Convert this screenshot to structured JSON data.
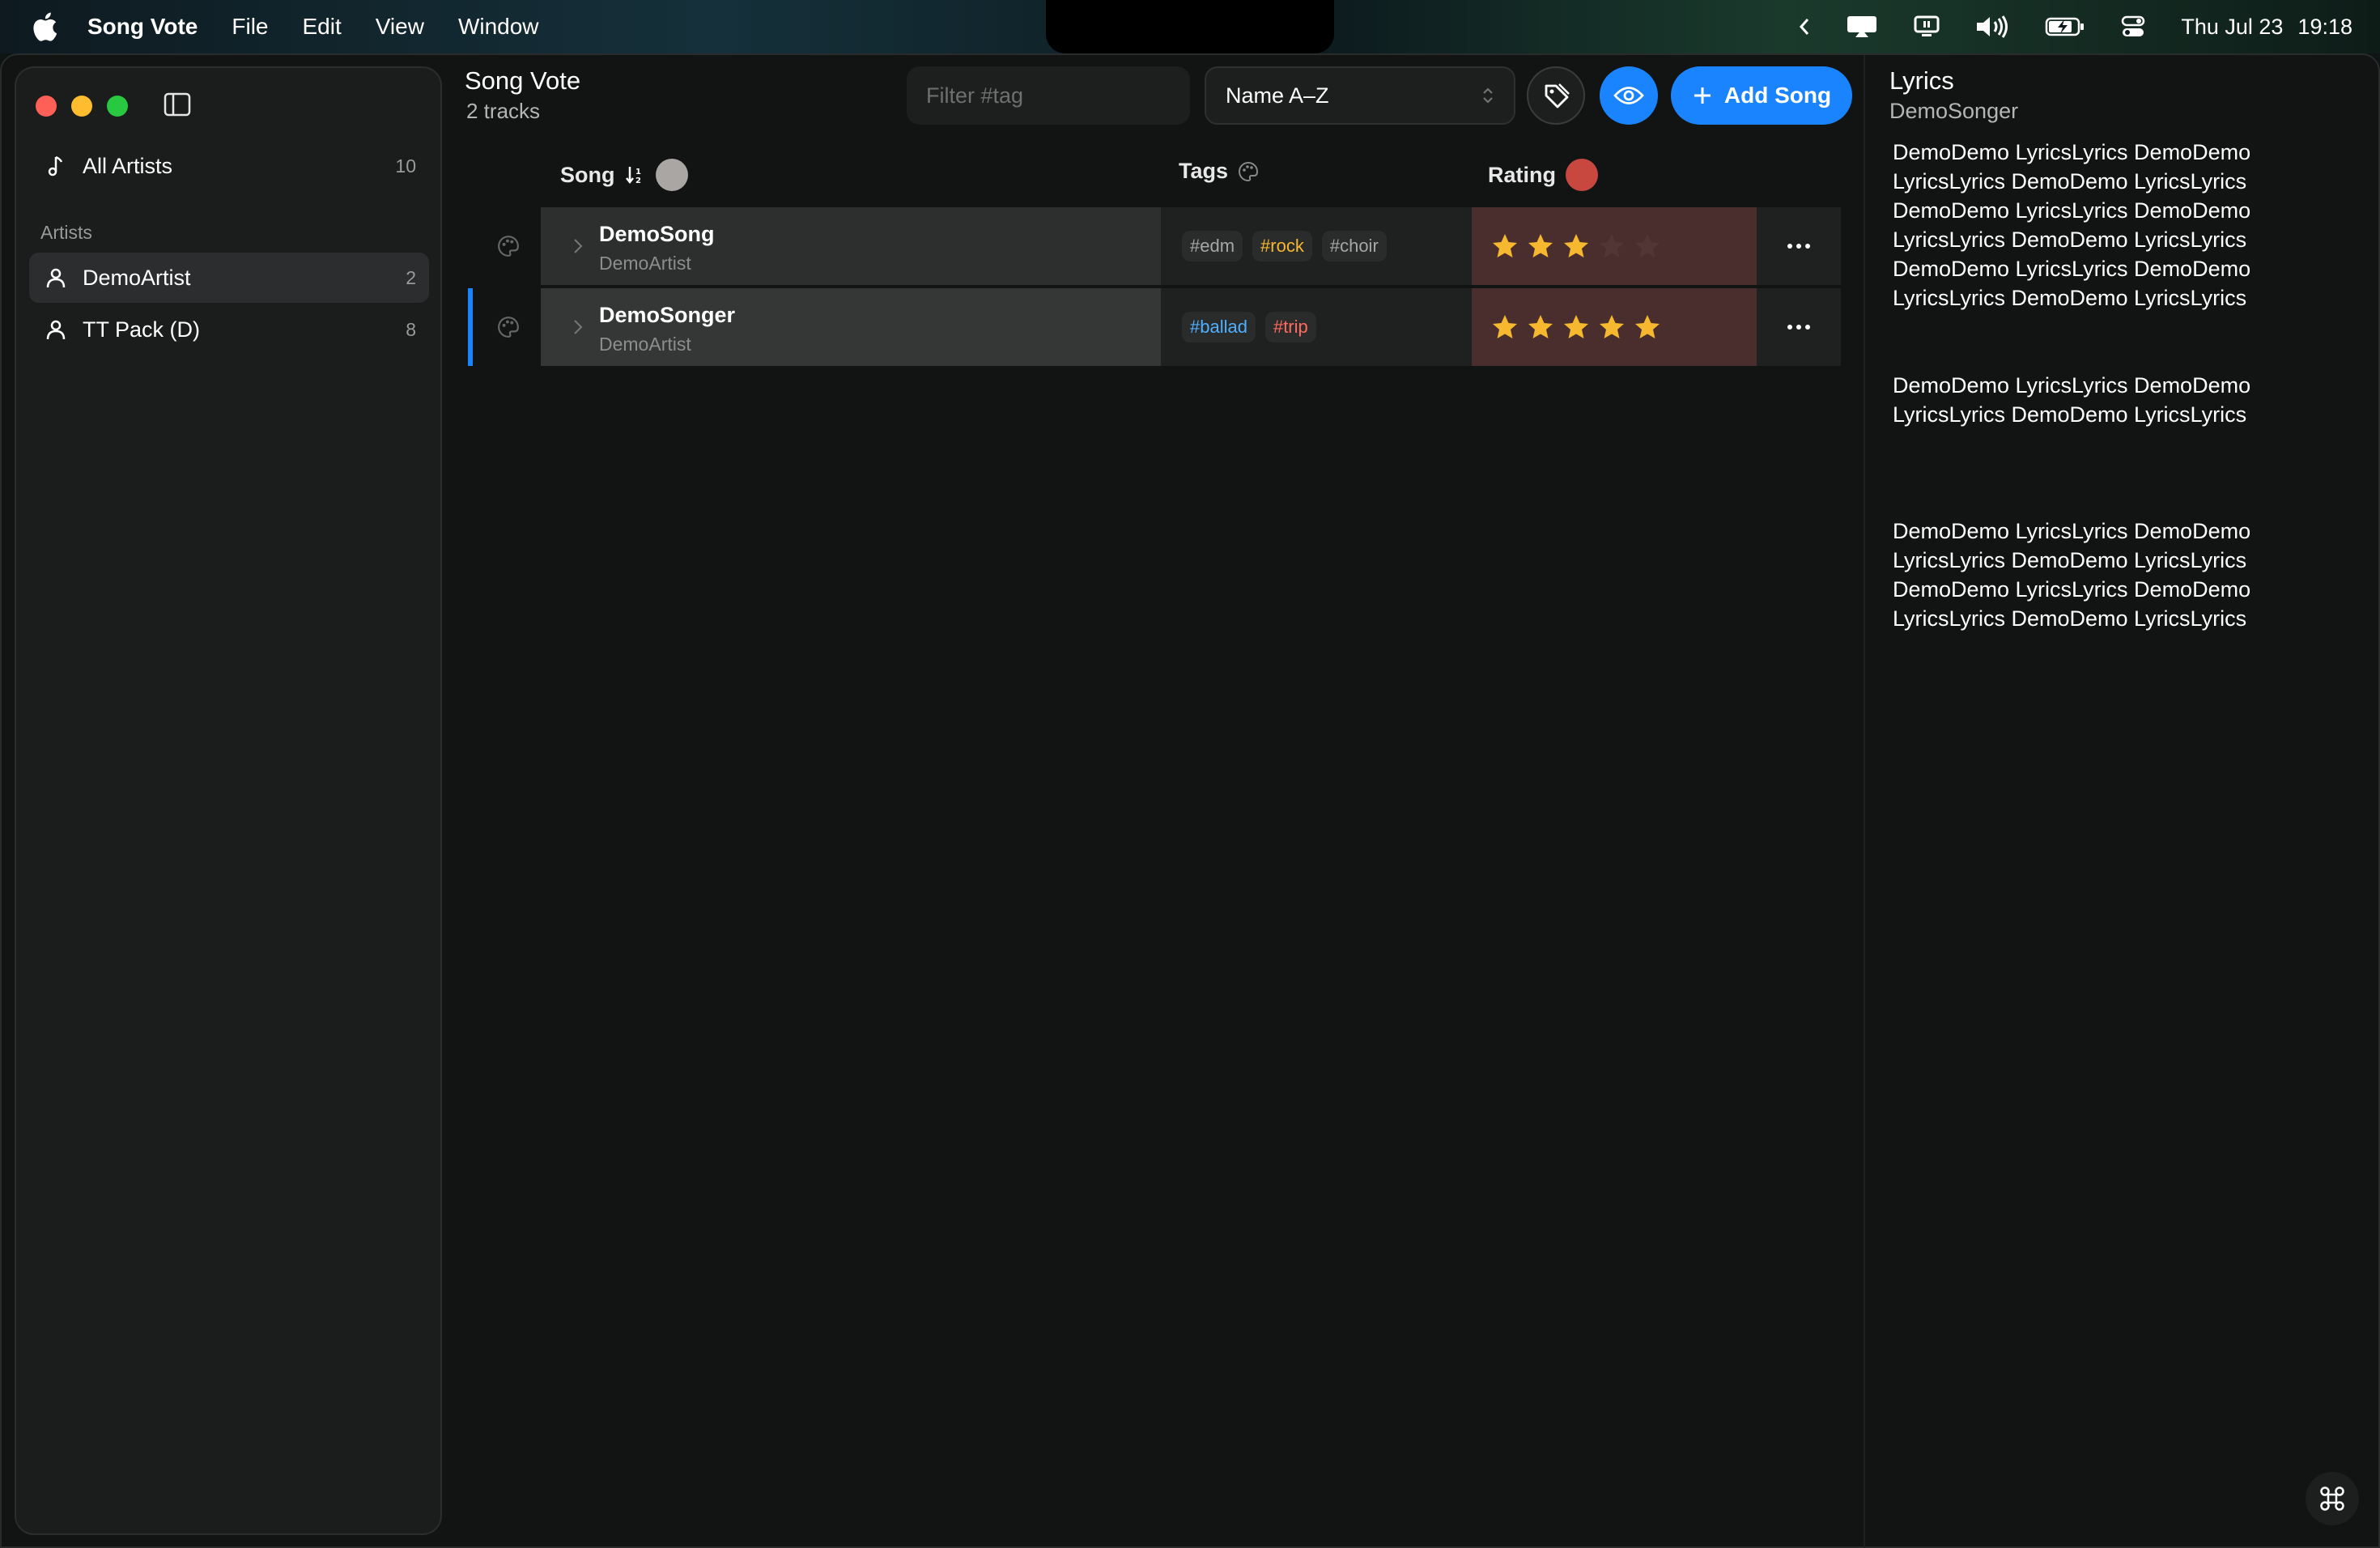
{
  "menubar": {
    "app_name": "Song Vote",
    "menus": [
      "File",
      "Edit",
      "View",
      "Window"
    ],
    "date": "Thu Jul 23",
    "time": "19:18"
  },
  "sidebar": {
    "all_artists": {
      "label": "All Artists",
      "count": "10"
    },
    "section_label": "Artists",
    "artists": [
      {
        "label": "DemoArtist",
        "count": "2",
        "selected": true
      },
      {
        "label": "TT Pack (D)",
        "count": "8",
        "selected": false
      }
    ]
  },
  "header": {
    "title": "Song Vote",
    "subtitle": "2 tracks",
    "filter_placeholder": "Filter #tag",
    "sort_value": "Name A–Z",
    "add_label": "Add Song"
  },
  "table": {
    "columns": {
      "song": "Song",
      "tags": "Tags",
      "rating": "Rating"
    },
    "rows": [
      {
        "title": "DemoSong",
        "artist": "DemoArtist",
        "tags": [
          {
            "text": "#edm",
            "color": "#a6a6a6"
          },
          {
            "text": "#rock",
            "color": "#f5b82e"
          },
          {
            "text": "#choir",
            "color": "#a6a6a6"
          }
        ],
        "rating": 3,
        "selected": false
      },
      {
        "title": "DemoSonger",
        "artist": "DemoArtist",
        "tags": [
          {
            "text": "#ballad",
            "color": "#4fb0ff"
          },
          {
            "text": "#trip",
            "color": "#ff6b5e"
          }
        ],
        "rating": 5,
        "selected": true
      }
    ]
  },
  "lyrics": {
    "title": "Lyrics",
    "song": "DemoSonger",
    "paragraphs": [
      [
        "DemoDemo LyricsLyrics DemoDemo",
        "LyricsLyrics DemoDemo LyricsLyrics",
        "DemoDemo LyricsLyrics DemoDemo",
        "LyricsLyrics DemoDemo LyricsLyrics",
        "DemoDemo LyricsLyrics DemoDemo",
        "LyricsLyrics DemoDemo LyricsLyrics"
      ],
      [
        "DemoDemo LyricsLyrics DemoDemo",
        "LyricsLyrics DemoDemo LyricsLyrics"
      ],
      [
        "DemoDemo LyricsLyrics DemoDemo",
        "LyricsLyrics DemoDemo LyricsLyrics",
        "DemoDemo LyricsLyrics DemoDemo",
        "LyricsLyrics DemoDemo LyricsLyrics"
      ]
    ]
  },
  "colors": {
    "accent": "#1a84ff",
    "star": "#f5b82e",
    "rating_cell": "#4a2e2d",
    "song_sort_dot": "#a9a6a3",
    "rating_dot": "#c8483f"
  },
  "icons": {
    "close": "red-traffic-light",
    "minimize": "yellow-traffic-light",
    "zoom": "green-traffic-light"
  }
}
